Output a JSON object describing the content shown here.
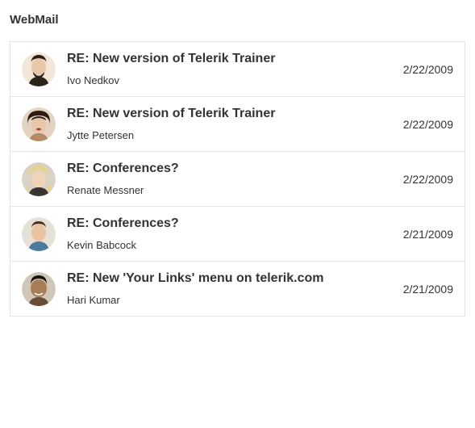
{
  "header": {
    "title": "WebMail"
  },
  "avatars": {
    "ivo_nedkov": {
      "bg": "#f2e6d8",
      "hair": "#2a1e18",
      "skin": "#e8c6a8",
      "beard": "#2a1e18"
    },
    "jytte_petersen": {
      "bg": "#e3d4c2",
      "hair": "#2d1a12",
      "skin": "#eac6ab",
      "lips": "#a33c3c"
    },
    "renate_messner": {
      "bg": "#d9d2c7",
      "hair": "#e8d28a",
      "skin": "#f1d3b8"
    },
    "kevin_babcock": {
      "bg": "#e6e1d6",
      "hair": "#4a2f1e",
      "skin": "#e9c2a1"
    },
    "hari_kumar": {
      "bg": "#cfc7b8",
      "hair": "#1a1411",
      "skin": "#a87c54"
    }
  },
  "mail": {
    "items": [
      {
        "subject": "RE: New version of Telerik Trainer",
        "sender": "Ivo Nedkov",
        "date": "2/22/2009",
        "avatar_key": "ivo_nedkov"
      },
      {
        "subject": "RE: New version of Telerik Trainer",
        "sender": "Jytte Petersen",
        "date": "2/22/2009",
        "avatar_key": "jytte_petersen"
      },
      {
        "subject": "RE: Conferences?",
        "sender": "Renate Messner",
        "date": "2/22/2009",
        "avatar_key": "renate_messner"
      },
      {
        "subject": "RE: Conferences?",
        "sender": "Kevin Babcock",
        "date": "2/21/2009",
        "avatar_key": "kevin_babcock"
      },
      {
        "subject": "RE: New 'Your Links' menu on telerik.com",
        "sender": "Hari Kumar",
        "date": "2/21/2009",
        "avatar_key": "hari_kumar"
      }
    ]
  }
}
